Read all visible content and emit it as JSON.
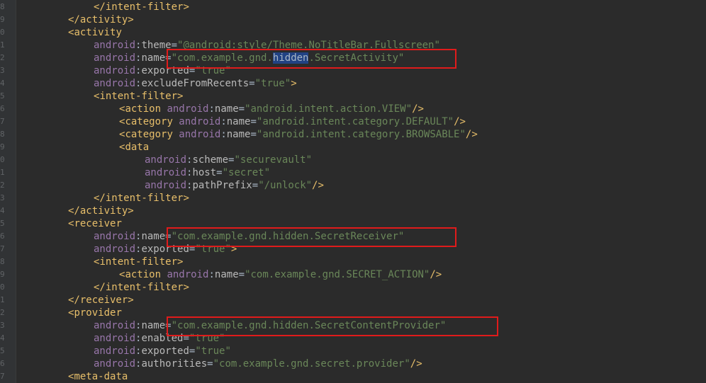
{
  "lines": [
    {
      "indent": 3,
      "tokens": [
        [
          "br",
          "</"
        ],
        [
          "tag",
          "intent-filter"
        ],
        [
          "br",
          ">"
        ]
      ]
    },
    {
      "indent": 2,
      "tokens": [
        [
          "br",
          "</"
        ],
        [
          "tag",
          "activity"
        ],
        [
          "br",
          ">"
        ]
      ]
    },
    {
      "indent": 2,
      "tokens": [
        [
          "br",
          "<"
        ],
        [
          "tag",
          "activity"
        ]
      ]
    },
    {
      "indent": 3,
      "tokens": [
        [
          "ns",
          "android"
        ],
        [
          "eq",
          ":"
        ],
        [
          "at",
          "theme"
        ],
        [
          "eq",
          "="
        ],
        [
          "val",
          "\"@android:style/Theme.NoTitleBar.Fullscreen\""
        ]
      ]
    },
    {
      "indent": 3,
      "tokens": [
        [
          "ns",
          "android"
        ],
        [
          "eq",
          ":"
        ],
        [
          "at",
          "name"
        ],
        [
          "eq",
          "="
        ],
        [
          "val",
          "\"com.example.gnd."
        ],
        [
          "sel",
          "hidden"
        ],
        [
          "val",
          ".SecretActivity\""
        ]
      ]
    },
    {
      "indent": 3,
      "tokens": [
        [
          "ns",
          "android"
        ],
        [
          "eq",
          ":"
        ],
        [
          "at",
          "exported"
        ],
        [
          "eq",
          "="
        ],
        [
          "val",
          "\"true\""
        ]
      ]
    },
    {
      "indent": 3,
      "tokens": [
        [
          "ns",
          "android"
        ],
        [
          "eq",
          ":"
        ],
        [
          "at",
          "excludeFromRecents"
        ],
        [
          "eq",
          "="
        ],
        [
          "val",
          "\"true\""
        ],
        [
          "br",
          ">"
        ]
      ]
    },
    {
      "indent": 3,
      "tokens": [
        [
          "br",
          "<"
        ],
        [
          "tag",
          "intent-filter"
        ],
        [
          "br",
          ">"
        ]
      ]
    },
    {
      "indent": 4,
      "tokens": [
        [
          "br",
          "<"
        ],
        [
          "tag",
          "action "
        ],
        [
          "ns",
          "android"
        ],
        [
          "eq",
          ":"
        ],
        [
          "at",
          "name"
        ],
        [
          "eq",
          "="
        ],
        [
          "val",
          "\"android.intent.action.VIEW\""
        ],
        [
          "br",
          "/>"
        ]
      ]
    },
    {
      "indent": 4,
      "tokens": [
        [
          "br",
          "<"
        ],
        [
          "tag",
          "category "
        ],
        [
          "ns",
          "android"
        ],
        [
          "eq",
          ":"
        ],
        [
          "at",
          "name"
        ],
        [
          "eq",
          "="
        ],
        [
          "val",
          "\"android.intent.category.DEFAULT\""
        ],
        [
          "br",
          "/>"
        ]
      ]
    },
    {
      "indent": 4,
      "tokens": [
        [
          "br",
          "<"
        ],
        [
          "tag",
          "category "
        ],
        [
          "ns",
          "android"
        ],
        [
          "eq",
          ":"
        ],
        [
          "at",
          "name"
        ],
        [
          "eq",
          "="
        ],
        [
          "val",
          "\"android.intent.category.BROWSABLE\""
        ],
        [
          "br",
          "/>"
        ]
      ]
    },
    {
      "indent": 4,
      "tokens": [
        [
          "br",
          "<"
        ],
        [
          "tag",
          "data"
        ]
      ]
    },
    {
      "indent": 5,
      "tokens": [
        [
          "ns",
          "android"
        ],
        [
          "eq",
          ":"
        ],
        [
          "at",
          "scheme"
        ],
        [
          "eq",
          "="
        ],
        [
          "val",
          "\"securevault\""
        ]
      ]
    },
    {
      "indent": 5,
      "tokens": [
        [
          "ns",
          "android"
        ],
        [
          "eq",
          ":"
        ],
        [
          "at",
          "host"
        ],
        [
          "eq",
          "="
        ],
        [
          "val",
          "\"secret\""
        ]
      ]
    },
    {
      "indent": 5,
      "tokens": [
        [
          "ns",
          "android"
        ],
        [
          "eq",
          ":"
        ],
        [
          "at",
          "pathPrefix"
        ],
        [
          "eq",
          "="
        ],
        [
          "val",
          "\"/unlock\""
        ],
        [
          "br",
          "/>"
        ]
      ]
    },
    {
      "indent": 3,
      "tokens": [
        [
          "br",
          "</"
        ],
        [
          "tag",
          "intent-filter"
        ],
        [
          "br",
          ">"
        ]
      ]
    },
    {
      "indent": 2,
      "tokens": [
        [
          "br",
          "</"
        ],
        [
          "tag",
          "activity"
        ],
        [
          "br",
          ">"
        ]
      ]
    },
    {
      "indent": 2,
      "tokens": [
        [
          "br",
          "<"
        ],
        [
          "tag",
          "receiver"
        ]
      ]
    },
    {
      "indent": 3,
      "tokens": [
        [
          "ns",
          "android"
        ],
        [
          "eq",
          ":"
        ],
        [
          "at",
          "name"
        ],
        [
          "eq",
          "="
        ],
        [
          "val",
          "\"com.example.gnd.hidden.SecretReceiver\""
        ]
      ]
    },
    {
      "indent": 3,
      "tokens": [
        [
          "ns",
          "android"
        ],
        [
          "eq",
          ":"
        ],
        [
          "at",
          "exported"
        ],
        [
          "eq",
          "="
        ],
        [
          "val",
          "\"true\""
        ],
        [
          "br",
          ">"
        ]
      ]
    },
    {
      "indent": 3,
      "tokens": [
        [
          "br",
          "<"
        ],
        [
          "tag",
          "intent-filter"
        ],
        [
          "br",
          ">"
        ]
      ]
    },
    {
      "indent": 4,
      "tokens": [
        [
          "br",
          "<"
        ],
        [
          "tag",
          "action "
        ],
        [
          "ns",
          "android"
        ],
        [
          "eq",
          ":"
        ],
        [
          "at",
          "name"
        ],
        [
          "eq",
          "="
        ],
        [
          "val",
          "\"com.example.gnd.SECRET_ACTION\""
        ],
        [
          "br",
          "/>"
        ]
      ]
    },
    {
      "indent": 3,
      "tokens": [
        [
          "br",
          "</"
        ],
        [
          "tag",
          "intent-filter"
        ],
        [
          "br",
          ">"
        ]
      ]
    },
    {
      "indent": 2,
      "tokens": [
        [
          "br",
          "</"
        ],
        [
          "tag",
          "receiver"
        ],
        [
          "br",
          ">"
        ]
      ]
    },
    {
      "indent": 2,
      "tokens": [
        [
          "br",
          "<"
        ],
        [
          "tag",
          "provider"
        ]
      ]
    },
    {
      "indent": 3,
      "tokens": [
        [
          "ns",
          "android"
        ],
        [
          "eq",
          ":"
        ],
        [
          "at",
          "name"
        ],
        [
          "eq",
          "="
        ],
        [
          "val",
          "\"com.example.gnd.hidden.SecretContentProvider\""
        ]
      ]
    },
    {
      "indent": 3,
      "tokens": [
        [
          "ns",
          "android"
        ],
        [
          "eq",
          ":"
        ],
        [
          "at",
          "enabled"
        ],
        [
          "eq",
          "="
        ],
        [
          "val",
          "\"true\""
        ]
      ]
    },
    {
      "indent": 3,
      "tokens": [
        [
          "ns",
          "android"
        ],
        [
          "eq",
          ":"
        ],
        [
          "at",
          "exported"
        ],
        [
          "eq",
          "="
        ],
        [
          "val",
          "\"true\""
        ]
      ]
    },
    {
      "indent": 3,
      "tokens": [
        [
          "ns",
          "android"
        ],
        [
          "eq",
          ":"
        ],
        [
          "at",
          "authorities"
        ],
        [
          "eq",
          "="
        ],
        [
          "val",
          "\"com.example.gnd.secret.provider\""
        ],
        [
          "br",
          "/>"
        ]
      ]
    },
    {
      "indent": 2,
      "tokens": [
        [
          "br",
          "<"
        ],
        [
          "tag",
          "meta-data"
        ]
      ]
    }
  ],
  "gutter_digits": [
    "8",
    "9",
    "0",
    "1",
    "2",
    "3",
    "4",
    "5",
    "6",
    "7",
    "8",
    "9",
    "0",
    "1",
    "2",
    "3",
    "4",
    "5",
    "6",
    "7",
    "8",
    "9",
    "0",
    "1",
    "2",
    "3",
    "4",
    "5",
    "6",
    "7"
  ],
  "annotations": [
    {
      "label": "highlight-secret-activity",
      "line": 4
    },
    {
      "label": "highlight-secret-receiver",
      "line": 18
    },
    {
      "label": "highlight-secret-content-provider",
      "line": 25
    }
  ],
  "colors": {
    "background": "#2b2b2b",
    "tag": "#e8bf6a",
    "namespace": "#9876aa",
    "attribute": "#bababa",
    "value": "#6a8759",
    "selection": "#214283",
    "annotation_box": "#e01b1b"
  }
}
